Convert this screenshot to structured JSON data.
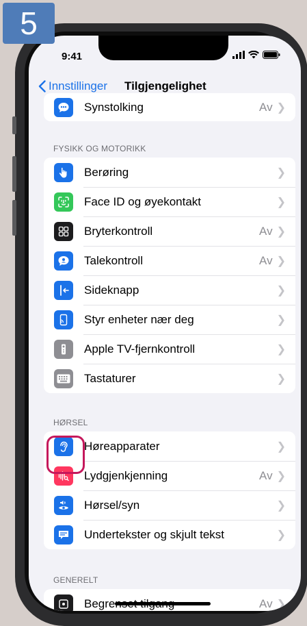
{
  "step": "5",
  "status": {
    "time": "9:41"
  },
  "nav": {
    "back_label": "Innstillinger",
    "title": "Tilgjengelighet"
  },
  "top_row": {
    "label": "Synstolking",
    "value": "Av"
  },
  "sections": {
    "fysikk": {
      "header": "FYSIKK OG MOTORIKK"
    },
    "horsel": {
      "header": "HØRSEL"
    },
    "generelt": {
      "header": "GENERELT"
    }
  },
  "fysikk_rows": [
    {
      "label": "Berøring",
      "value": ""
    },
    {
      "label": "Face ID og øyekontakt",
      "value": ""
    },
    {
      "label": "Bryterkontroll",
      "value": "Av"
    },
    {
      "label": "Talekontroll",
      "value": "Av"
    },
    {
      "label": "Sideknapp",
      "value": ""
    },
    {
      "label": "Styr enheter nær deg",
      "value": ""
    },
    {
      "label": "Apple TV-fjernkontroll",
      "value": ""
    },
    {
      "label": "Tastaturer",
      "value": ""
    }
  ],
  "horsel_rows": [
    {
      "label": "Høreapparater",
      "value": ""
    },
    {
      "label": "Lydgjenkjenning",
      "value": "Av"
    },
    {
      "label": "Hørsel/syn",
      "value": ""
    },
    {
      "label": "Undertekster og skjult tekst",
      "value": ""
    }
  ],
  "generelt_row": {
    "label": "Begrenset tilgang",
    "value": "Av"
  },
  "colors": {
    "accent": "#1b72e8",
    "highlight": "#c5185c",
    "badge": "#4f7cb8"
  }
}
